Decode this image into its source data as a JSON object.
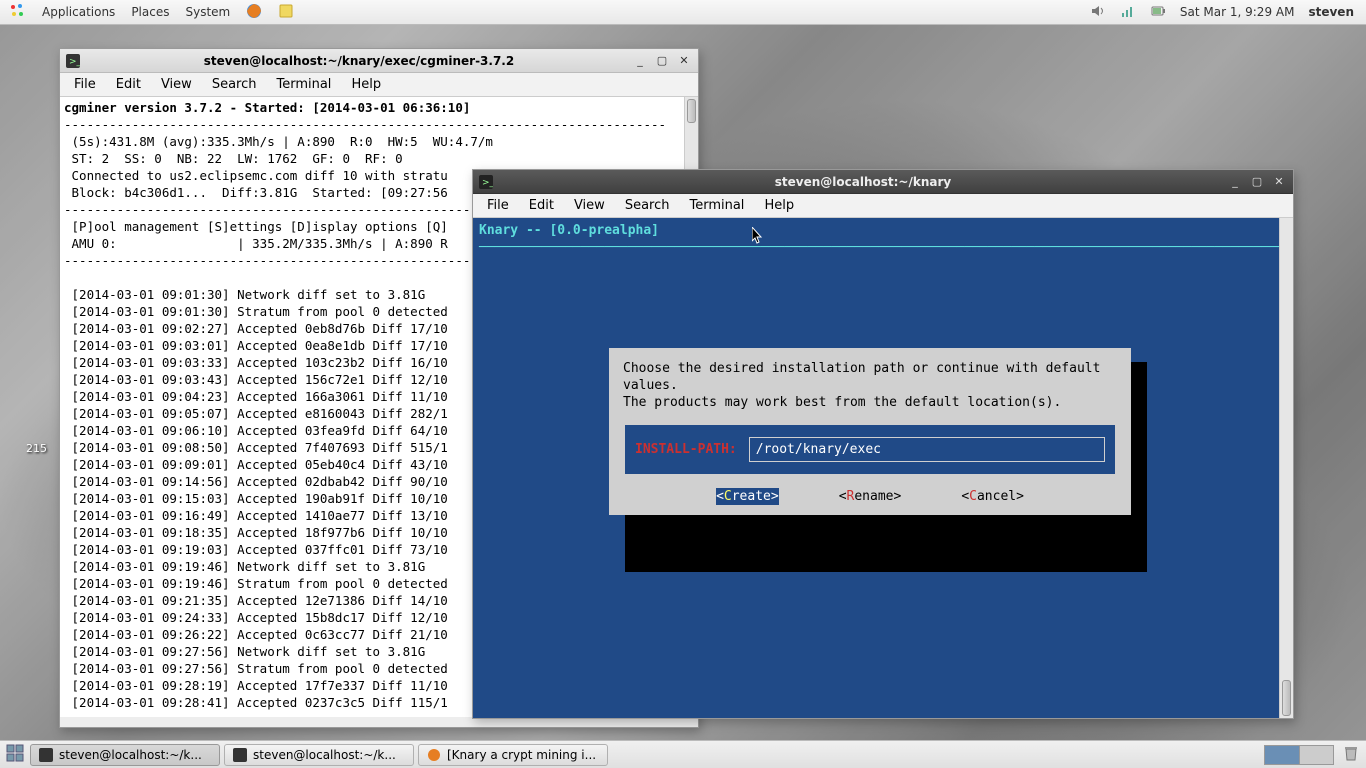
{
  "panel": {
    "applications": "Applications",
    "places": "Places",
    "system": "System",
    "clock": "Sat Mar 1,  9:29 AM",
    "user": "steven"
  },
  "taskbar": {
    "task1": "steven@localhost:~/k...",
    "task2": "steven@localhost:~/k...",
    "task3": "[Knary a crypt mining i..."
  },
  "term1": {
    "title": "steven@localhost:~/knary/exec/cgminer-3.7.2",
    "menu": {
      "file": "File",
      "edit": "Edit",
      "view": "View",
      "search": "Search",
      "terminal": "Terminal",
      "help": "Help"
    },
    "header": "cgminer version 3.7.2 - Started: [2014-03-01 06:36:10]",
    "stats1": " (5s):431.8M (avg):335.3Mh/s | A:890  R:0  HW:5  WU:4.7/m",
    "stats2": " ST: 2  SS: 0  NB: 22  LW: 1762  GF: 0  RF: 0",
    "stats3": " Connected to us2.eclipsemc.com diff 10 with stratu",
    "stats4": " Block: b4c306d1...  Diff:3.81G  Started: [09:27:56",
    "menu_line": " [P]ool management [S]ettings [D]isplay options [Q]",
    "amu": " AMU 0:                | 335.2M/335.3Mh/s | A:890 R",
    "log": [
      " [2014-03-01 09:01:30] Network diff set to 3.81G",
      " [2014-03-01 09:01:30] Stratum from pool 0 detected",
      " [2014-03-01 09:02:27] Accepted 0eb8d76b Diff 17/10",
      " [2014-03-01 09:03:01] Accepted 0ea8e1db Diff 17/10",
      " [2014-03-01 09:03:33] Accepted 103c23b2 Diff 16/10",
      " [2014-03-01 09:03:43] Accepted 156c72e1 Diff 12/10",
      " [2014-03-01 09:04:23] Accepted 166a3061 Diff 11/10",
      " [2014-03-01 09:05:07] Accepted e8160043 Diff 282/1",
      " [2014-03-01 09:06:10] Accepted 03fea9fd Diff 64/10",
      " [2014-03-01 09:08:50] Accepted 7f407693 Diff 515/1",
      " [2014-03-01 09:09:01] Accepted 05eb40c4 Diff 43/10",
      " [2014-03-01 09:14:56] Accepted 02dbab42 Diff 90/10",
      " [2014-03-01 09:15:03] Accepted 190ab91f Diff 10/10",
      " [2014-03-01 09:16:49] Accepted 1410ae77 Diff 13/10",
      " [2014-03-01 09:18:35] Accepted 18f977b6 Diff 10/10",
      " [2014-03-01 09:19:03] Accepted 037ffc01 Diff 73/10",
      " [2014-03-01 09:19:46] Network diff set to 3.81G",
      " [2014-03-01 09:19:46] Stratum from pool 0 detected",
      " [2014-03-01 09:21:35] Accepted 12e71386 Diff 14/10",
      " [2014-03-01 09:24:33] Accepted 15b8dc17 Diff 12/10",
      " [2014-03-01 09:26:22] Accepted 0c63cc77 Diff 21/10",
      " [2014-03-01 09:27:56] Network diff set to 3.81G",
      " [2014-03-01 09:27:56] Stratum from pool 0 detected",
      " [2014-03-01 09:28:19] Accepted 17f7e337 Diff 11/10",
      " [2014-03-01 09:28:41] Accepted 0237c3c5 Diff 115/1"
    ]
  },
  "term2": {
    "title": "steven@localhost:~/knary",
    "menu": {
      "file": "File",
      "edit": "Edit",
      "view": "View",
      "search": "Search",
      "terminal": "Terminal",
      "help": "Help"
    },
    "app_title": "Knary -- [0.0-prealpha]",
    "dialog": {
      "text": "Choose the desired installation path or continue with default\nvalues.\nThe products may work best from the default location(s).",
      "label": "INSTALL-PATH:",
      "value": "/root/knary/exec",
      "create": "Create",
      "rename": "Rename",
      "cancel": "Cancel"
    }
  },
  "desk": {
    "num": "215"
  }
}
